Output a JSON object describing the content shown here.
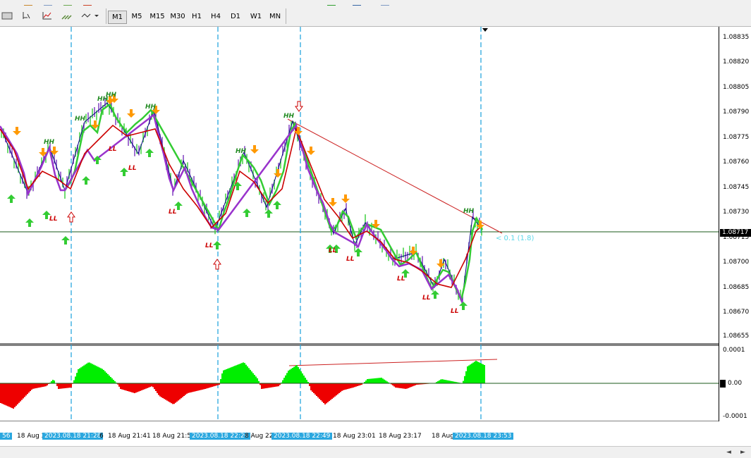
{
  "toolbar": {
    "timeframes": [
      "M1",
      "M5",
      "M15",
      "M30",
      "H1",
      "H4",
      "D1",
      "W1",
      "MN"
    ],
    "active_timeframe": "M1"
  },
  "main_chart": {
    "price_labels": [
      "1.08835",
      "1.08820",
      "1.08805",
      "1.08790",
      "1.08775",
      "1.08760",
      "1.08745",
      "1.08730",
      "1.08715",
      "1.08700",
      "1.08685",
      "1.08670",
      "1.08655"
    ],
    "current_price": "1.08717",
    "channel_label": "< 0.1 (1.8)",
    "markers_hh": [
      "HH",
      "HH",
      "HH",
      "HH",
      "HH",
      "HH",
      "HH"
    ],
    "markers_ll": [
      "LL",
      "LL",
      "LL",
      "LL",
      "LL",
      "LL",
      "LL",
      "LL",
      "LL",
      "LL",
      "LL"
    ]
  },
  "sub_chart": {
    "scale_labels": [
      "0.0001",
      "0.00",
      "-0.0001"
    ]
  },
  "time_axis": {
    "labels": [
      "56",
      "18 Aug 2",
      "6",
      "18 Aug 21:41",
      "18 Aug 21:5",
      "8 Aug 22",
      "18 Aug 23:01",
      "18 Aug 23:17",
      "18 Aug 23"
    ],
    "highlighted": [
      "2023.08.18 21:28",
      "2023.08.18 22:20",
      "2023.08.18 22:49",
      "2023.08.18 23:53"
    ]
  },
  "colors": {
    "bull_line": "#33cc33",
    "bear_line": "#9933cc",
    "ma_line": "#cc0000",
    "zigzag": "#000080",
    "up_arrow": "#33cc33",
    "down_arrow": "#ff9900",
    "hh_text": "#228b22",
    "ll_text": "#cc0000",
    "histo_pos": "#00ee00",
    "histo_neg": "#ee0000",
    "vline": "#2aa7df",
    "channel_text": "#5ad8e8"
  }
}
